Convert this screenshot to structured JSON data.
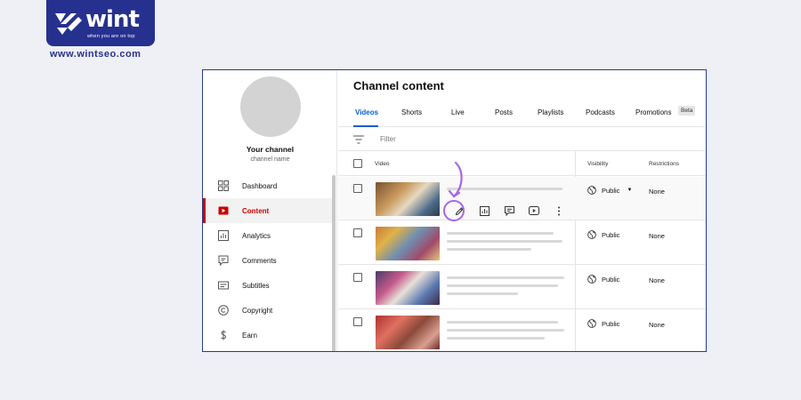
{
  "brand": {
    "logo_text": "wint",
    "tagline": "when you are on top",
    "url": "www.wintseo.com",
    "color": "#26318f"
  },
  "sidebar": {
    "channel_title": "Your channel",
    "channel_subtitle": "channel name",
    "items": [
      {
        "label": "Dashboard",
        "icon": "dashboard-icon"
      },
      {
        "label": "Content",
        "icon": "content-icon",
        "active": true
      },
      {
        "label": "Analytics",
        "icon": "analytics-icon"
      },
      {
        "label": "Comments",
        "icon": "comments-icon"
      },
      {
        "label": "Subtitles",
        "icon": "subtitles-icon"
      },
      {
        "label": "Copyright",
        "icon": "copyright-icon"
      },
      {
        "label": "Earn",
        "icon": "earn-icon"
      }
    ]
  },
  "main": {
    "title": "Channel content",
    "tabs": [
      "Videos",
      "Shorts",
      "Live",
      "Posts",
      "Playlists",
      "Podcasts",
      "Promotions"
    ],
    "active_tab": "Videos",
    "beta_label": "Beta",
    "filter_placeholder": "Filter",
    "columns": {
      "video": "Video",
      "visibility": "Visibility",
      "restrictions": "Restrictions"
    },
    "rows": [
      {
        "visibility": "Public",
        "restrictions": "None",
        "hover": true
      },
      {
        "visibility": "Public",
        "restrictions": "None"
      },
      {
        "visibility": "Public",
        "restrictions": "None"
      },
      {
        "visibility": "Public",
        "restrictions": "None"
      }
    ],
    "row_actions": [
      "edit-icon",
      "analytics-icon",
      "comments-icon",
      "youtube-icon",
      "more-options-icon"
    ]
  },
  "colors": {
    "accent": "#065fd4",
    "active_nav": "#cc0000",
    "highlight": "#a866e6"
  }
}
